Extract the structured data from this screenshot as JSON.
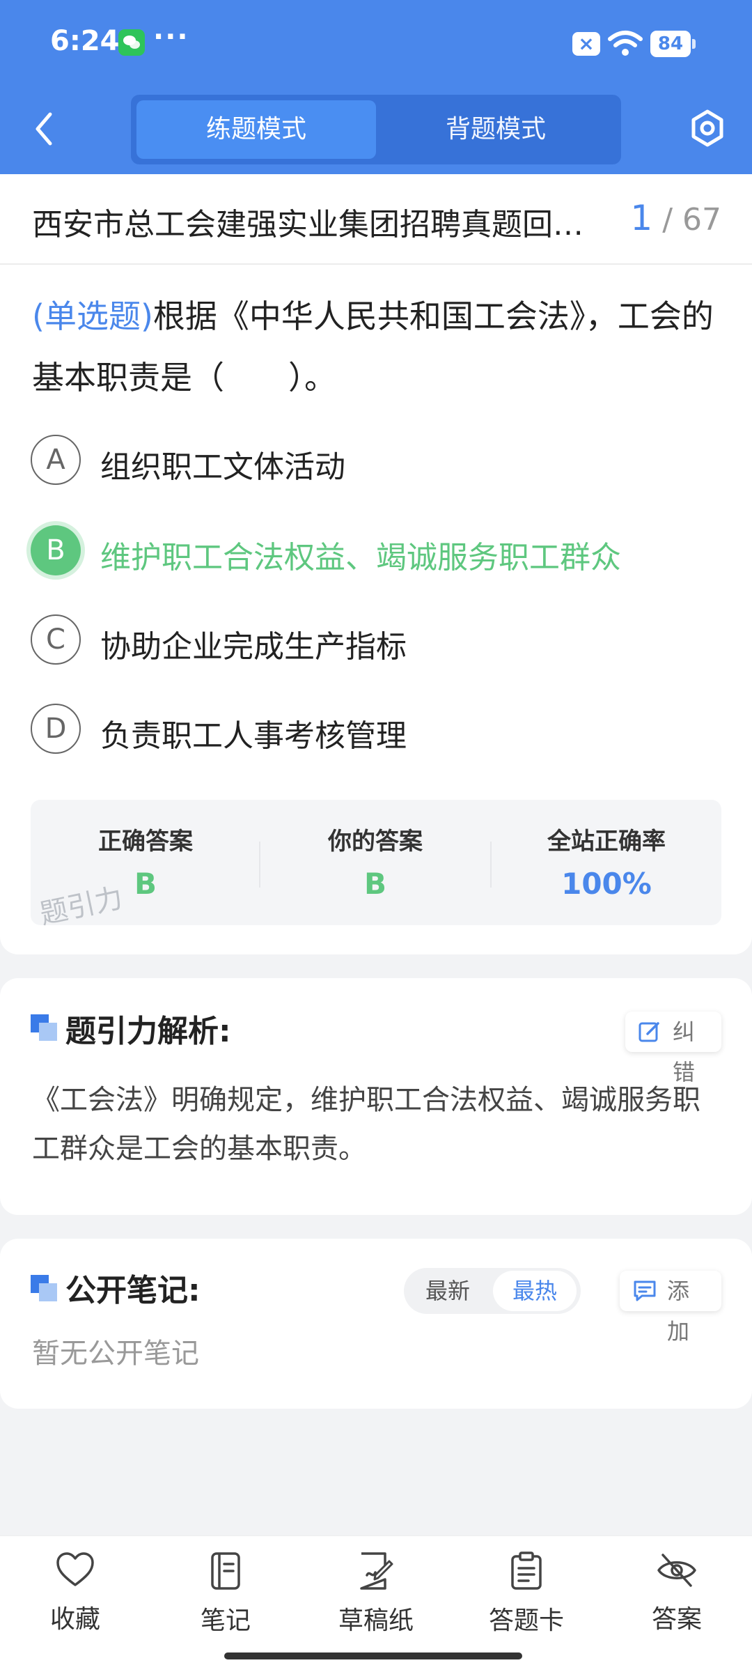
{
  "status_bar": {
    "time": "6:24",
    "dots": "···",
    "battery": "84"
  },
  "header": {
    "mode_practice": "练题模式",
    "mode_memorize": "背题模式"
  },
  "title_row": {
    "title": "西安市总工会建强实业集团招聘真题回…",
    "current": "1",
    "total": "/ 67"
  },
  "question": {
    "type": "(单选题)",
    "text": "根据《中华人民共和国工会法》，工会的基本职责是（　　）。",
    "options": [
      {
        "letter": "A",
        "text": "组织职工文体活动"
      },
      {
        "letter": "B",
        "text": "维护职工合法权益、竭诚服务职工群众"
      },
      {
        "letter": "C",
        "text": "协助企业完成生产指标"
      },
      {
        "letter": "D",
        "text": "负责职工人事考核管理"
      }
    ]
  },
  "answer_box": {
    "correct_label": "正确答案",
    "correct_value": "B",
    "yours_label": "你的答案",
    "yours_value": "B",
    "rate_label": "全站正确率",
    "rate_value": "100%",
    "watermark": "题引力"
  },
  "analysis": {
    "title": "题引力解析:",
    "correct_btn": "纠错",
    "text": "《工会法》明确规定，维护职工合法权益、竭诚服务职工群众是工会的基本职责。"
  },
  "notes": {
    "title": "公开笔记:",
    "sort_latest": "最新",
    "sort_hot": "最热",
    "add_btn": "添加",
    "empty": "暂无公开笔记"
  },
  "bottom_bar": {
    "items": [
      {
        "label": "收藏",
        "icon": "heart-icon"
      },
      {
        "label": "笔记",
        "icon": "notebook-icon"
      },
      {
        "label": "草稿纸",
        "icon": "draft-icon"
      },
      {
        "label": "答题卡",
        "icon": "clipboard-icon"
      },
      {
        "label": "答案",
        "icon": "eye-off-icon"
      }
    ]
  },
  "colors": {
    "brand_blue": "#4a87eb",
    "correct_green": "#5ec77f"
  }
}
